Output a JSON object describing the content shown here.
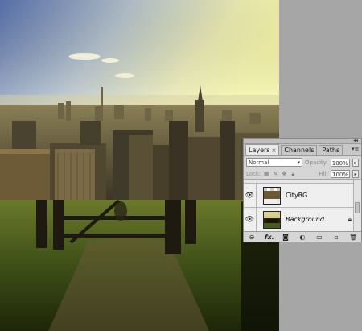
{
  "panel": {
    "tabs": [
      {
        "label": "Layers",
        "active": true
      },
      {
        "label": "Channels",
        "active": false
      },
      {
        "label": "Paths",
        "active": false
      }
    ],
    "blend_mode": "Normal",
    "opacity_label": "Opacity:",
    "opacity_value": "100%",
    "lock_label": "Lock:",
    "fill_label": "Fill:",
    "fill_value": "100%",
    "layers": [
      {
        "name": "CityBG",
        "visible": true,
        "italic": false
      },
      {
        "name": "Background",
        "visible": true,
        "italic": true,
        "locked": true
      }
    ],
    "footer_icons": [
      "link-layers-icon",
      "fx-icon",
      "add-mask-icon",
      "adjustment-layer-icon",
      "group-folder-icon",
      "new-layer-icon",
      "trash-icon"
    ]
  },
  "colors": {
    "canvas_bg": "#a6a6a6",
    "panel_bg": "#d6d6d6"
  }
}
